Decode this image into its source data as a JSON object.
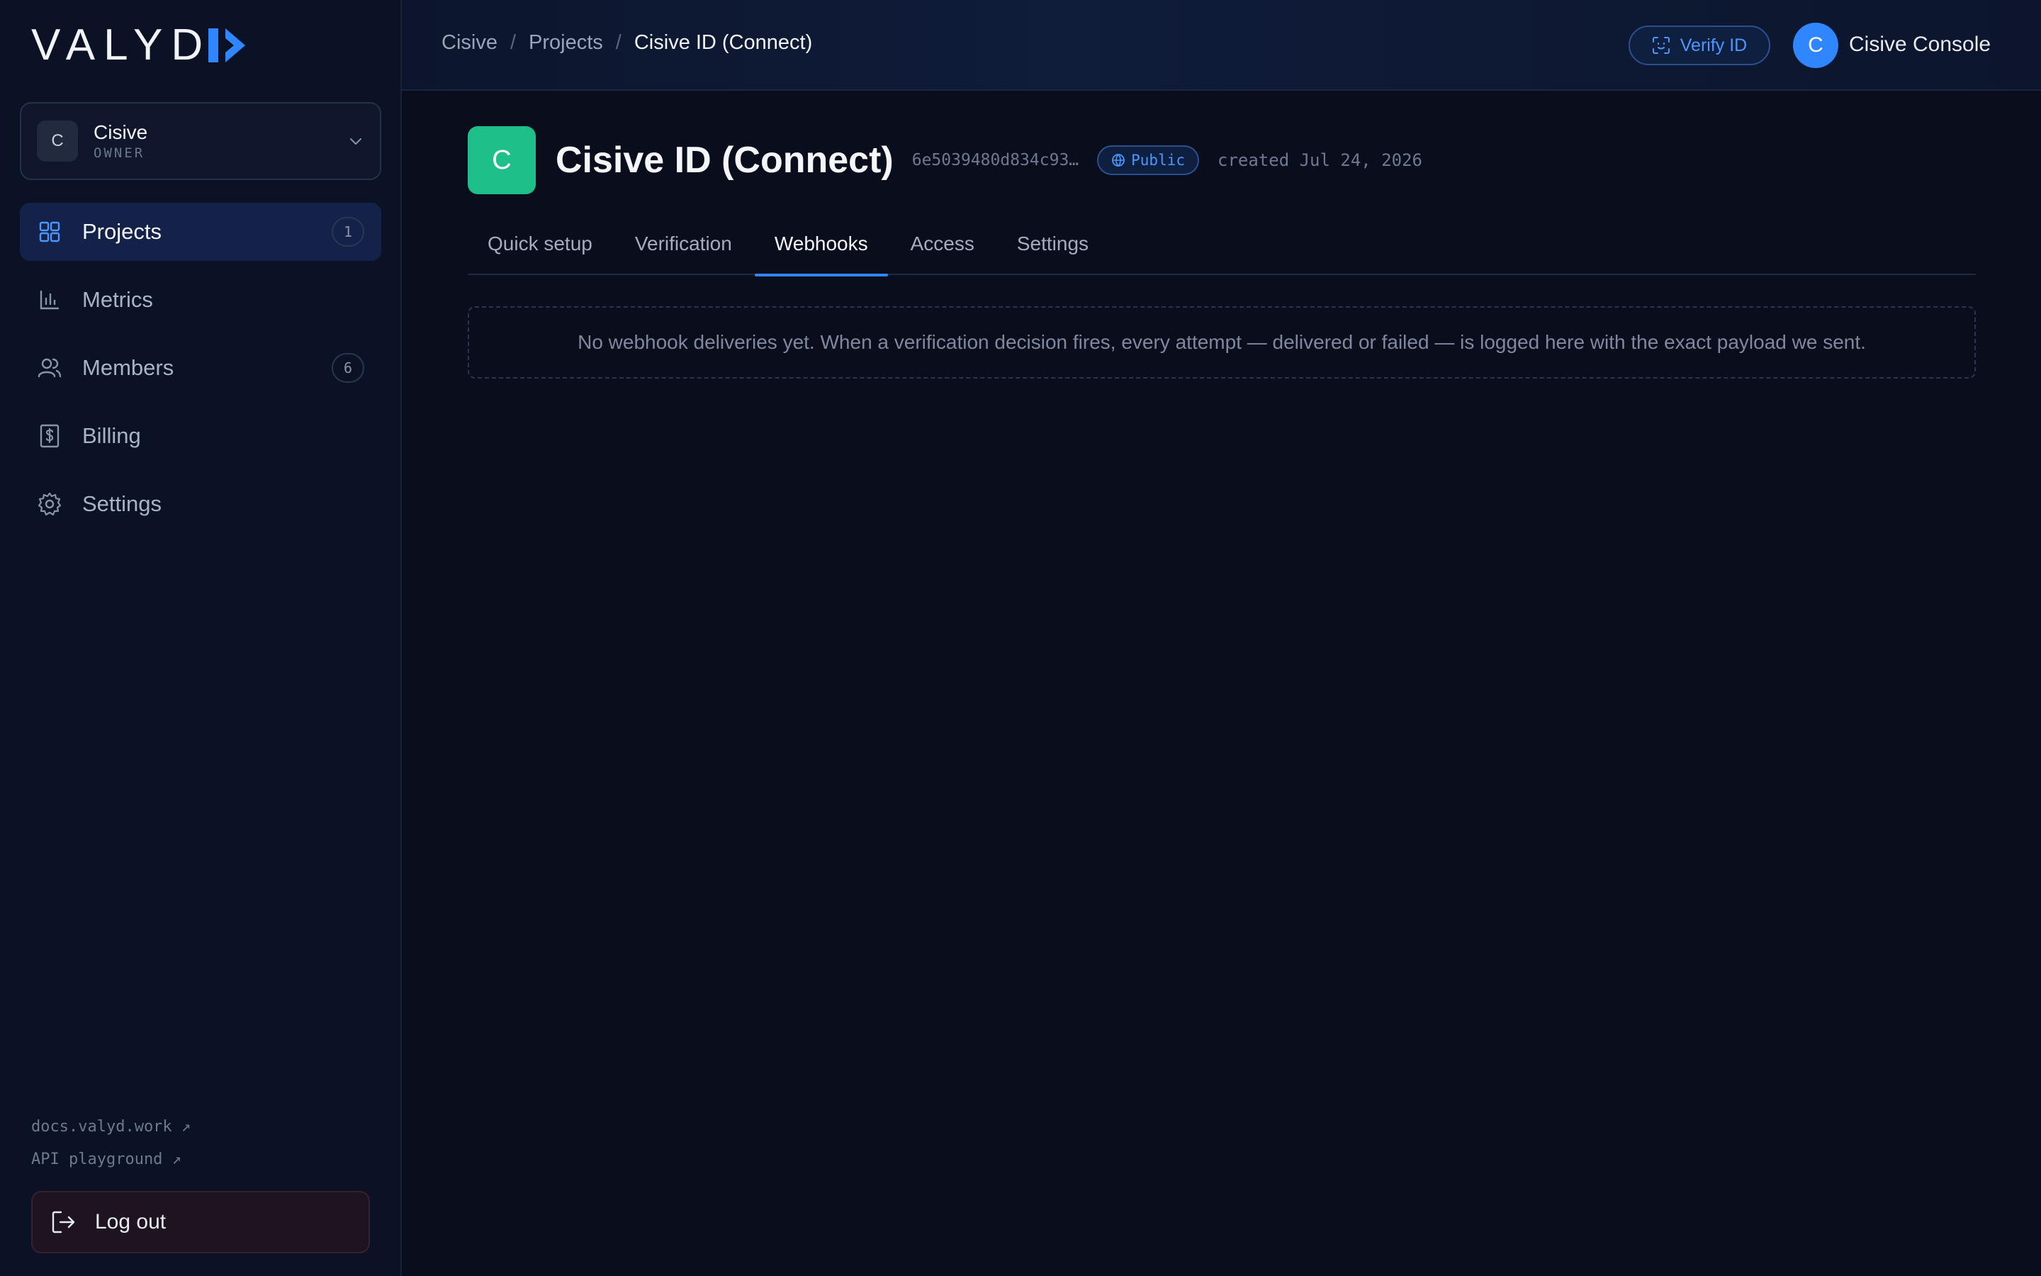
{
  "brand": {
    "logo_text": "VALYD",
    "logo_tail": "I"
  },
  "org": {
    "avatar": "C",
    "name": "Cisive",
    "role": "OWNER"
  },
  "nav": {
    "items": [
      {
        "label": "Projects",
        "badge": "1",
        "icon": "grid-icon",
        "active": true
      },
      {
        "label": "Metrics",
        "icon": "bar-chart-icon"
      },
      {
        "label": "Members",
        "badge": "6",
        "icon": "users-icon"
      },
      {
        "label": "Billing",
        "icon": "receipt-dollar-icon"
      },
      {
        "label": "Settings",
        "icon": "gear-icon"
      }
    ]
  },
  "footer_links": {
    "docs": "docs.valyd.work ↗",
    "api": "API playground ↗"
  },
  "logout": {
    "label": "Log out"
  },
  "breadcrumb": {
    "items": [
      "Cisive",
      "Projects"
    ],
    "current": "Cisive ID (Connect)",
    "separator": "/"
  },
  "header": {
    "verify_label": "Verify ID",
    "user_avatar": "C",
    "user_name": "Cisive Console"
  },
  "project": {
    "icon_letter": "C",
    "title": "Cisive ID (Connect)",
    "id": "6e5039480d834c93…",
    "visibility": "Public",
    "created": "created Jul 24, 2026"
  },
  "tabs": [
    "Quick setup",
    "Verification",
    "Webhooks",
    "Access",
    "Settings"
  ],
  "active_tab": "Webhooks",
  "webhooks": {
    "empty_message": "No webhook deliveries yet. When a verification decision fires, every attempt — delivered or failed — is logged here with the exact payload we sent."
  },
  "colors": {
    "accent": "#2f86ff",
    "project_icon": "#1fbf8a",
    "background": "#0a0e1c",
    "sidebar": "#0c1226"
  }
}
